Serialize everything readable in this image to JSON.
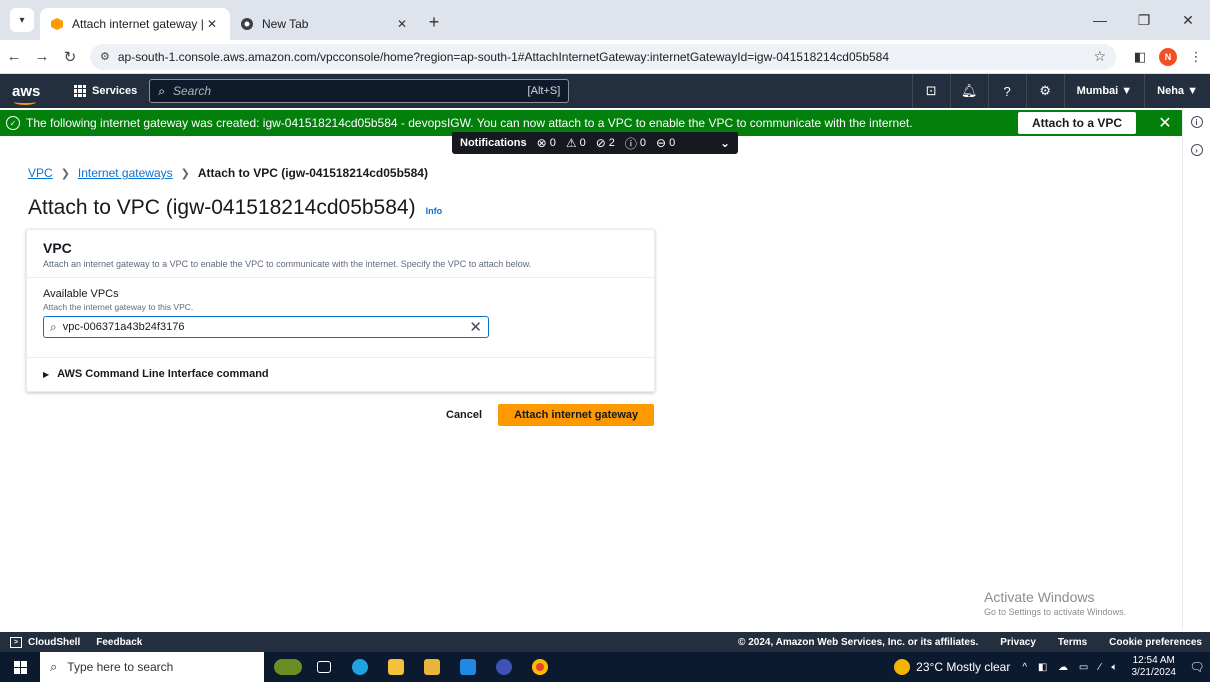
{
  "browser": {
    "tabs": [
      {
        "title": "Attach internet gateway | VPC M",
        "active": true
      },
      {
        "title": "New Tab",
        "active": false
      }
    ],
    "url": "ap-south-1.console.aws.amazon.com/vpcconsole/home?region=ap-south-1#AttachInternetGateway:internetGatewayId=igw-041518214cd05b584",
    "profile_initial": "N"
  },
  "aws_nav": {
    "logo": "aws",
    "services_label": "Services",
    "search_placeholder": "Search",
    "search_hint": "[Alt+S]",
    "region": "Mumbai ▼",
    "user": "Neha ▼"
  },
  "flash": {
    "message": "The following internet gateway was created: igw-041518214cd05b584 - devopsIGW. You can now attach to a VPC to enable the VPC to communicate with the internet.",
    "action_label": "Attach to a VPC"
  },
  "notifications": {
    "label": "Notifications",
    "counts": {
      "error": "0",
      "warning": "0",
      "success": "2",
      "info": "0",
      "pending": "0"
    }
  },
  "breadcrumb": {
    "items": [
      "VPC",
      "Internet gateways"
    ],
    "current": "Attach to VPC (igw-041518214cd05b584)"
  },
  "page": {
    "title": "Attach to VPC (igw-041518214cd05b584)",
    "info_label": "Info"
  },
  "panel": {
    "heading": "VPC",
    "description": "Attach an internet gateway to a VPC to enable the VPC to communicate with the internet. Specify the VPC to attach below.",
    "field_label": "Available VPCs",
    "field_description": "Attach the internet gateway to this VPC.",
    "field_value": "vpc-006371a43b24f3176",
    "cli_label": "AWS Command Line Interface command"
  },
  "actions": {
    "cancel_label": "Cancel",
    "submit_label": "Attach internet gateway"
  },
  "watermark": {
    "line1": "Activate Windows",
    "line2": "Go to Settings to activate Windows."
  },
  "aws_footer": {
    "cloudshell": "CloudShell",
    "feedback": "Feedback",
    "copyright": "© 2024, Amazon Web Services, Inc. or its affiliates.",
    "privacy": "Privacy",
    "terms": "Terms",
    "cookies": "Cookie preferences"
  },
  "taskbar": {
    "search_placeholder": "Type here to search",
    "weather": "23°C  Mostly clear",
    "time": "12:54 AM",
    "date": "3/21/2024"
  },
  "colors": {
    "aws_dark": "#232f3e",
    "success_green": "#037f0c",
    "primary_orange": "#ff9900",
    "link_blue": "#0972d3"
  }
}
